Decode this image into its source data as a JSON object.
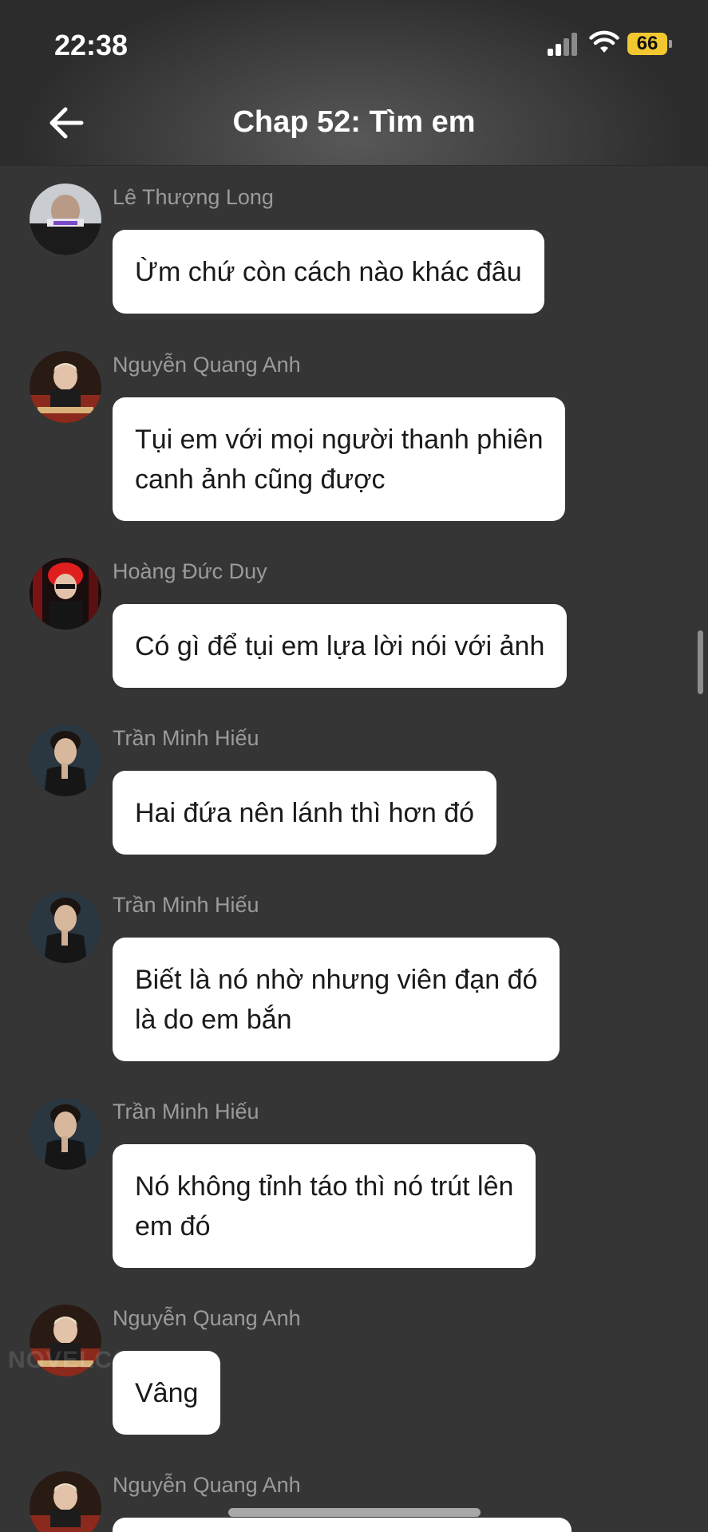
{
  "status_bar": {
    "time": "22:38",
    "battery": "66"
  },
  "header": {
    "title": "Chap 52: Tìm em"
  },
  "messages": [
    {
      "sender": "Lê Thượng Long",
      "lines": [
        "Ừm chứ còn cách nào khác đâu"
      ]
    },
    {
      "sender": "Nguyễn Quang Anh",
      "lines": [
        "Tụi em với mọi người thanh phiên",
        "canh ảnh cũng được"
      ]
    },
    {
      "sender": "Hoàng Đức Duy",
      "lines": [
        "Có gì để tụi em lựa lời nói với ảnh"
      ]
    },
    {
      "sender": "Trần Minh Hiếu",
      "lines": [
        "Hai đứa nên lánh thì hơn đó"
      ]
    },
    {
      "sender": "Trần Minh Hiếu",
      "lines": [
        "Biết là nó nhờ nhưng viên đạn đó",
        "là do em bắn"
      ]
    },
    {
      "sender": "Trần Minh Hiếu",
      "lines": [
        "Nó không tỉnh táo thì nó trút lên",
        "em đó"
      ]
    },
    {
      "sender": "Nguyễn Quang Anh",
      "lines": [
        "Vâng"
      ]
    },
    {
      "sender": "Nguyễn Quang Anh",
      "lines": [
        ""
      ]
    }
  ],
  "watermark": "NOVELCON"
}
